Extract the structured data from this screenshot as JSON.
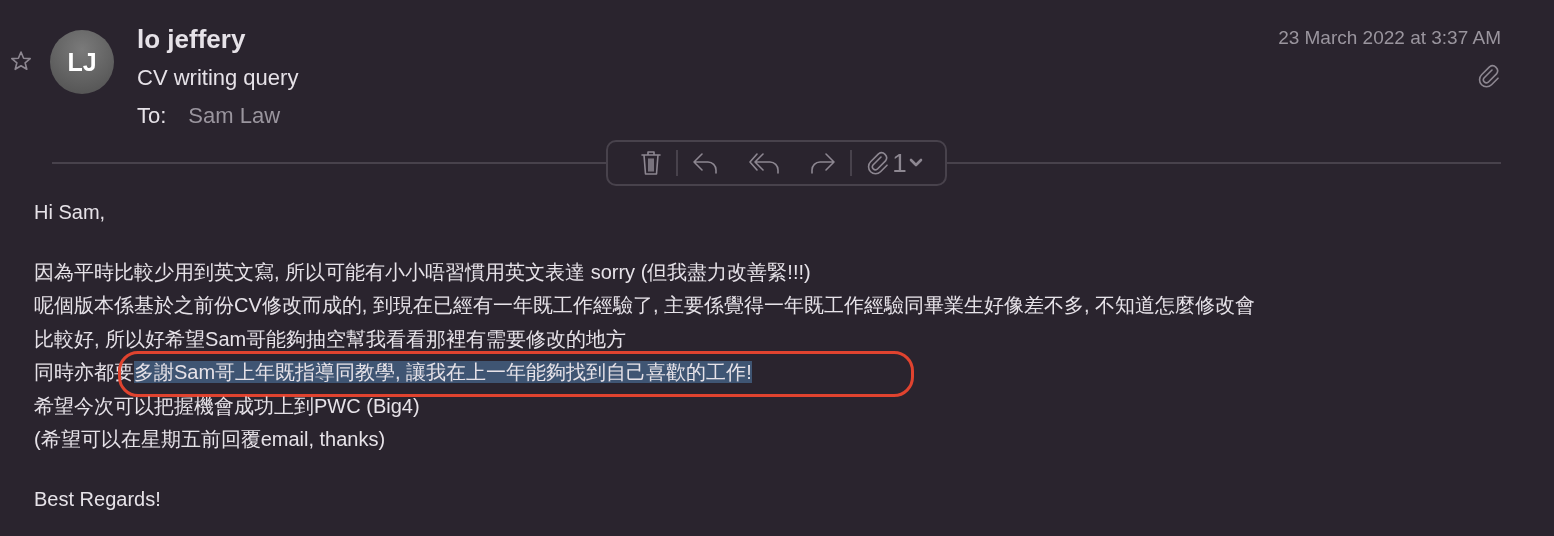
{
  "message": {
    "starred": false,
    "avatar_initials": "LJ",
    "sender": "lo jeffery",
    "subject": "CV writing query",
    "to_label": "To:",
    "recipient": "Sam Law",
    "date": "23 March 2022 at 3:37 AM",
    "has_attachment": true
  },
  "toolbar": {
    "attachment_count": "1"
  },
  "body": {
    "paragraphs": [
      [
        {
          "circled": false,
          "segments": [
            {
              "text": "Hi Sam,",
              "selected": false
            }
          ]
        }
      ],
      [
        {
          "circled": false,
          "segments": [
            {
              "text": "因為平時比較少用到英文寫, 所以可能有小小唔習慣用英文表達 sorry (但我盡力改善緊!!!)",
              "selected": false
            }
          ]
        },
        {
          "circled": false,
          "segments": [
            {
              "text": "呢個版本係基於之前份CV修改而成的, 到現在已經有一年既工作經驗了, 主要係覺得一年既工作經驗同畢業生好像差不多, 不知道怎麼修改會",
              "selected": false
            }
          ]
        },
        {
          "circled": false,
          "segments": [
            {
              "text": "比較好, 所以好希望Sam哥能夠抽空幫我看看那裡有需要修改的地方",
              "selected": false
            }
          ]
        },
        {
          "circled": true,
          "segments": [
            {
              "text": "同時亦都要",
              "selected": false
            },
            {
              "text": "多謝Sam哥上年既指導同教學, 讓我在上一年能夠找到自己喜歡的工作!",
              "selected": true
            }
          ]
        },
        {
          "circled": false,
          "segments": [
            {
              "text": "希望今次可以把握機會成功上到PWC (Big4)",
              "selected": false
            }
          ]
        },
        {
          "circled": false,
          "segments": [
            {
              "text": "(希望可以在星期五前回覆email, thanks)",
              "selected": false
            }
          ]
        }
      ],
      [
        {
          "circled": false,
          "segments": [
            {
              "text": "Best Regards!",
              "selected": false
            }
          ]
        }
      ]
    ]
  }
}
